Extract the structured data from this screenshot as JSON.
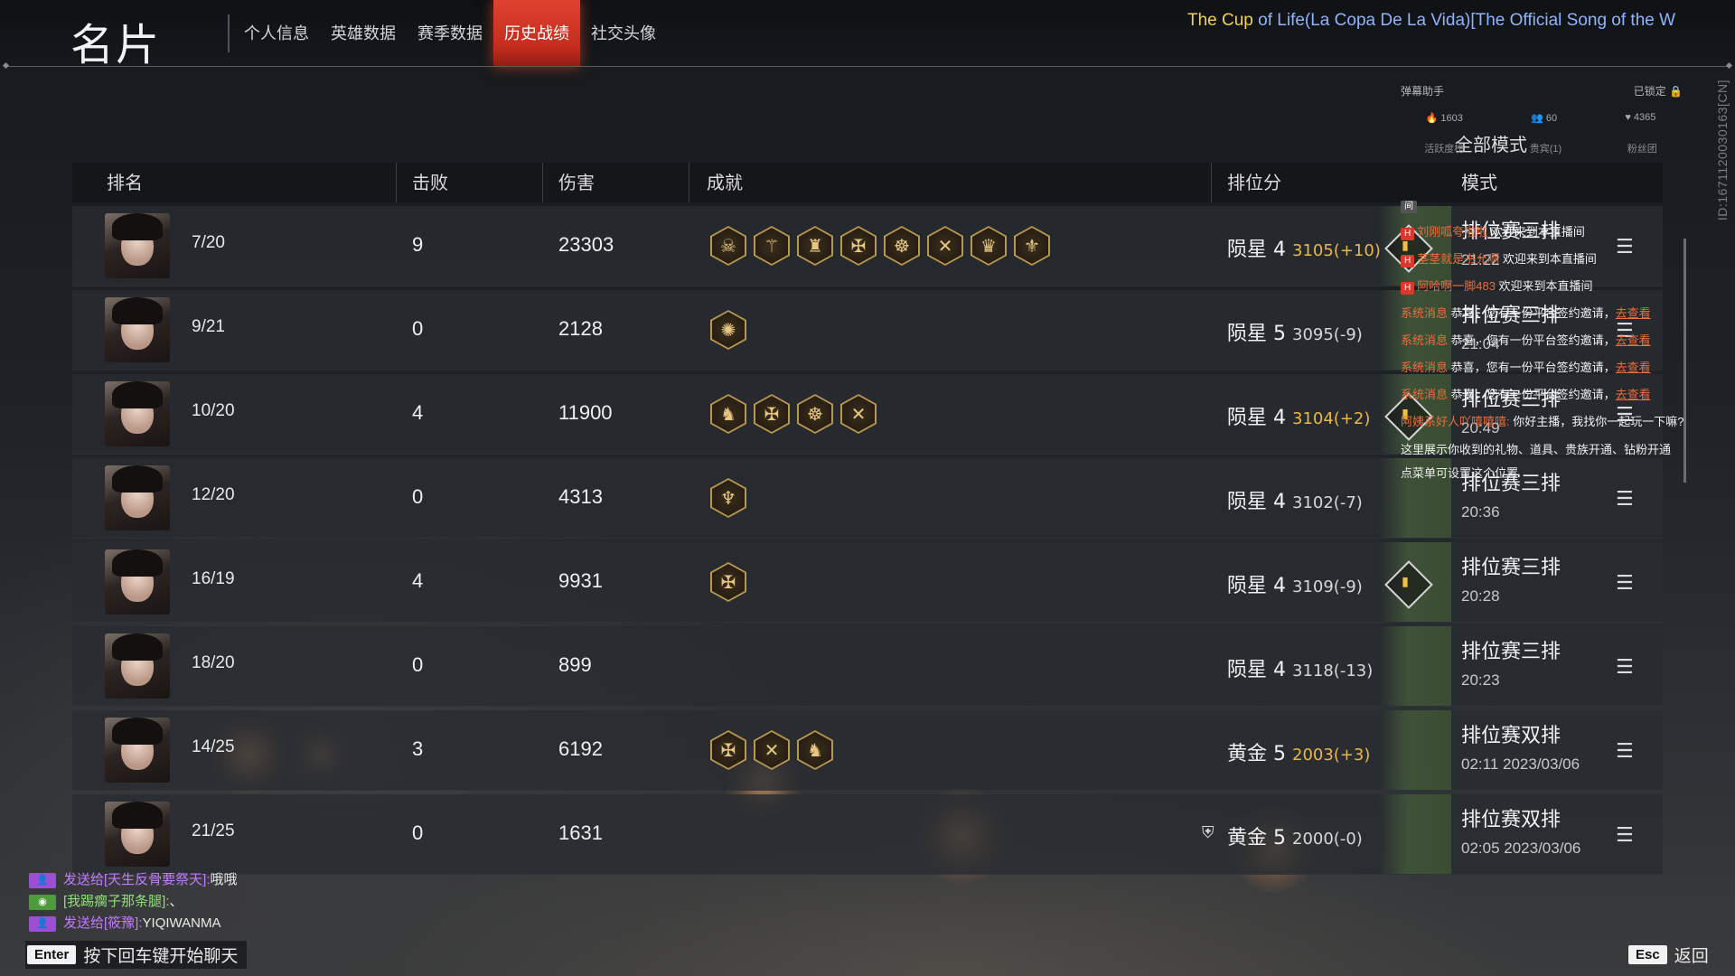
{
  "header": {
    "title": "名片",
    "tabs": [
      {
        "label": "个人信息"
      },
      {
        "label": "英雄数据"
      },
      {
        "label": "赛季数据"
      },
      {
        "label": "历史战绩",
        "active": true
      },
      {
        "label": "社交头像"
      }
    ],
    "song_prefix": "The Cup",
    "song_rest": " of Life(La Copa De La Vida)[The Official Song of the W",
    "side_id": "ID:1671120030163[CN]"
  },
  "table": {
    "headers": {
      "rank": "排名",
      "kills": "击败",
      "damage": "伤害",
      "achievements": "成就",
      "score": "排位分",
      "mode": "模式"
    },
    "rows": [
      {
        "rank": "7/20",
        "kills": "9",
        "damage": "23303",
        "achievements": [
          "☠",
          "⚚",
          "♜",
          "✠",
          "☸",
          "✕",
          "♛",
          "⚜"
        ],
        "tier": "陨星 4",
        "points": "3105(+10)",
        "up": true,
        "mvp": true,
        "mode": "排位赛三排",
        "time": "21:22"
      },
      {
        "rank": "9/21",
        "kills": "0",
        "damage": "2128",
        "achievements": [
          "✺"
        ],
        "tier": "陨星 5",
        "points": "3095(-9)",
        "up": false,
        "mvp": false,
        "mode": "排位赛三排",
        "time": "21:04"
      },
      {
        "rank": "10/20",
        "kills": "4",
        "damage": "11900",
        "achievements": [
          "♞",
          "✠",
          "☸",
          "✕"
        ],
        "tier": "陨星 4",
        "points": "3104(+2)",
        "up": true,
        "mvp": true,
        "mode": "排位赛三排",
        "time": "20:49"
      },
      {
        "rank": "12/20",
        "kills": "0",
        "damage": "4313",
        "achievements": [
          "♆"
        ],
        "tier": "陨星 4",
        "points": "3102(-7)",
        "up": false,
        "mvp": false,
        "mode": "排位赛三排",
        "time": "20:36"
      },
      {
        "rank": "16/19",
        "kills": "4",
        "damage": "9931",
        "achievements": [
          "✠"
        ],
        "tier": "陨星 4",
        "points": "3109(-9)",
        "up": false,
        "mvp": true,
        "mode": "排位赛三排",
        "time": "20:28"
      },
      {
        "rank": "18/20",
        "kills": "0",
        "damage": "899",
        "achievements": [],
        "tier": "陨星 4",
        "points": "3118(-13)",
        "up": false,
        "mvp": false,
        "mode": "排位赛三排",
        "time": "20:23"
      },
      {
        "rank": "14/25",
        "kills": "3",
        "damage": "6192",
        "achievements": [
          "✠",
          "✕",
          "♞"
        ],
        "tier": "黄金 5",
        "points": "2003(+3)",
        "up": true,
        "mvp": false,
        "mode": "排位赛双排",
        "time": "02:11  2023/03/06"
      },
      {
        "rank": "21/25",
        "kills": "0",
        "damage": "1631",
        "achievements": [],
        "tier": "黄金 5",
        "points": "2000(-0)",
        "up": false,
        "mvp": false,
        "shield": true,
        "mode": "排位赛双排",
        "time": "02:05  2023/03/06"
      }
    ]
  },
  "danmaku": {
    "title": "弹幕助手",
    "lock": "已锁定",
    "stats": [
      "🔥 1603",
      "👥 60",
      "♥ 4365"
    ],
    "sub": [
      "活跃度榜",
      "贵宾(1)",
      "粉丝团"
    ],
    "mode_label": "全部模式",
    "lines": [
      {
        "pre": "间",
        "name": "",
        "text": ""
      },
      {
        "pre": "H",
        "name": "刘刚呱夸啦啦",
        "text": " 欢迎来到本直播间"
      },
      {
        "pre": "H",
        "name": "茎茎就是书允啊",
        "text": " 欢迎来到本直播间"
      },
      {
        "pre": "H",
        "name": "阿哈啊一脚483",
        "text": " 欢迎来到本直播间"
      },
      {
        "pre": "",
        "name": "系统消息",
        "text": "  恭喜，您有一份平台签约邀请，",
        "go": "去查看"
      },
      {
        "pre": "",
        "name": "系统消息",
        "text": "  恭喜，您有一份平台签约邀请，",
        "go": "去查看"
      },
      {
        "pre": "",
        "name": "系统消息",
        "text": "  恭喜，您有一份平台签约邀请，",
        "go": "去查看"
      },
      {
        "pre": "",
        "name": "系统消息",
        "text": "  恭喜，您有一份平台签约邀请，",
        "go": "去查看"
      },
      {
        "pre": "",
        "name": "阿姨系好人吖嘻嘻嘻:",
        "text": " 你好主播，我找你一起玩一下嘛?"
      }
    ],
    "note1": "这里展示你收到的礼物、道具、贵族开通、钻粉开通",
    "note2": "点菜单可设置这个位置"
  },
  "chat": {
    "lines": [
      {
        "who": "发送给[天生反骨要祭天]:",
        "msg": "哦哦",
        "kind": "pur"
      },
      {
        "who": "[我踢瘸子那条腿]:",
        "msg": " 、",
        "kind": "grn"
      },
      {
        "who": "发送给[筱豫]:",
        "msg": "YIQIWANMA",
        "kind": "pur"
      }
    ],
    "enter_key": "Enter",
    "enter_hint": "按下回车键开始聊天",
    "esc_key": "Esc",
    "esc_label": "返回"
  },
  "colors": {
    "accent_tab": "#d8392a",
    "score_up": "#e8b84b",
    "song_hl": "#f3d24c",
    "song": "#8fb4ff"
  }
}
